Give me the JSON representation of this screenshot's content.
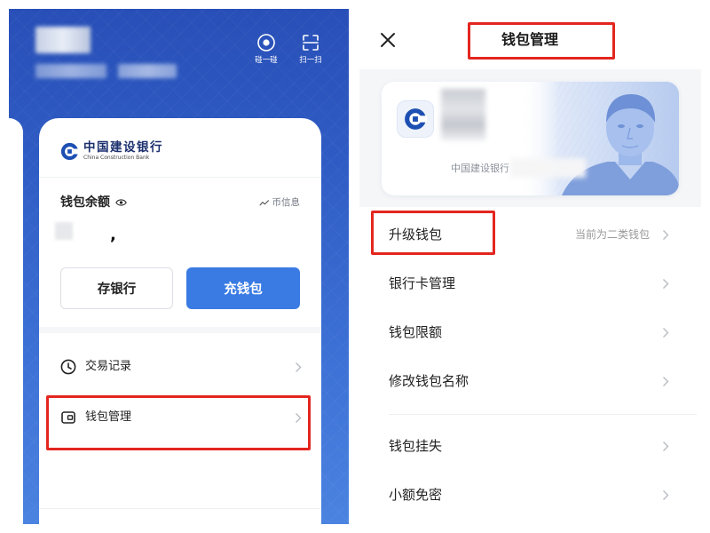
{
  "left_panel": {
    "header": {
      "actions": [
        {
          "label": "碰一碰",
          "icon": "tap-circle-icon"
        },
        {
          "label": "扫一扫",
          "icon": "scan-icon"
        }
      ]
    },
    "card": {
      "bank_name_cn": "中国建设银行",
      "bank_name_en": "China Construction Bank",
      "balance_label": "钱包余额",
      "info_link": "币信息",
      "balance_mark": ",",
      "buttons": {
        "deposit_to_bank": "存银行",
        "top_up_wallet": "充钱包"
      },
      "menu": [
        {
          "label": "交易记录",
          "icon": "clock-icon",
          "highlighted": false
        },
        {
          "label": "钱包管理",
          "icon": "wallet-icon",
          "highlighted": true
        }
      ]
    }
  },
  "right_panel": {
    "title": "钱包管理",
    "title_highlighted": true,
    "card": {
      "bank_name": "中国建设银行"
    },
    "menu": [
      {
        "label": "升级钱包",
        "value": "当前为二类钱包",
        "highlighted": true
      },
      {
        "label": "银行卡管理"
      },
      {
        "label": "钱包限额"
      },
      {
        "label": "修改钱包名称"
      },
      {
        "label": "钱包挂失"
      },
      {
        "label": "小额免密"
      }
    ]
  },
  "colors": {
    "brand_blue": "#2c58c2",
    "button_blue": "#3a7be3",
    "highlight_red": "#e3261f",
    "text_primary": "#1f1f1f",
    "text_secondary": "#999999"
  }
}
